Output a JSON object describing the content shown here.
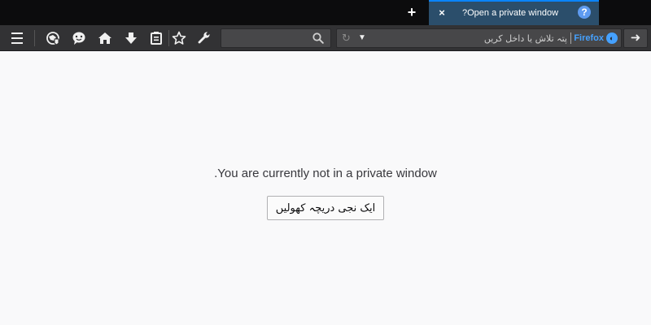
{
  "tabs": {
    "active": {
      "title": "Open a private window?",
      "favicon": "help-icon",
      "favicon_glyph": "?",
      "close_glyph": "×"
    },
    "new_tab_glyph": "+"
  },
  "toolbar": {
    "url": {
      "identity_label": "Firefox",
      "placeholder": "پتہ تلاش یا داخل کریں",
      "value": ""
    },
    "search": {
      "placeholder": "",
      "value": ""
    },
    "icons": [
      "menu-icon",
      "vpn-icon",
      "chat-icon",
      "home-icon",
      "download-icon",
      "library-icon",
      "bookmark-star-icon",
      "wrench-icon"
    ]
  },
  "page": {
    "message": "You are currently not in a private window.",
    "button_label": "ایک نجی دریچہ کھولیں"
  },
  "colors": {
    "tabstrip": "#0c0c0d",
    "active_tab": "#2b4e6b",
    "accent": "#0a84ff",
    "toolbar": "#323234",
    "field": "#474749",
    "identity": "#45a1ff",
    "page_bg": "#f9f9fa"
  }
}
